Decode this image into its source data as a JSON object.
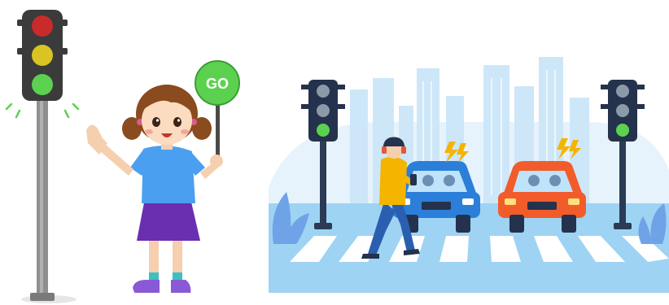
{
  "illustration": {
    "sign_text": "GO",
    "colors": {
      "light_green": "#5cd14f",
      "light_off": "#8a9aa8",
      "light_red": "#c92a2a",
      "light_yellow": "#d9c421",
      "city_blue": "#cde7f8",
      "road": "#9ed3f3",
      "car_blue": "#2b7fd9",
      "car_orange": "#f25c2b",
      "shirt": "#4b9ff0",
      "skirt": "#6a2fb0"
    }
  }
}
